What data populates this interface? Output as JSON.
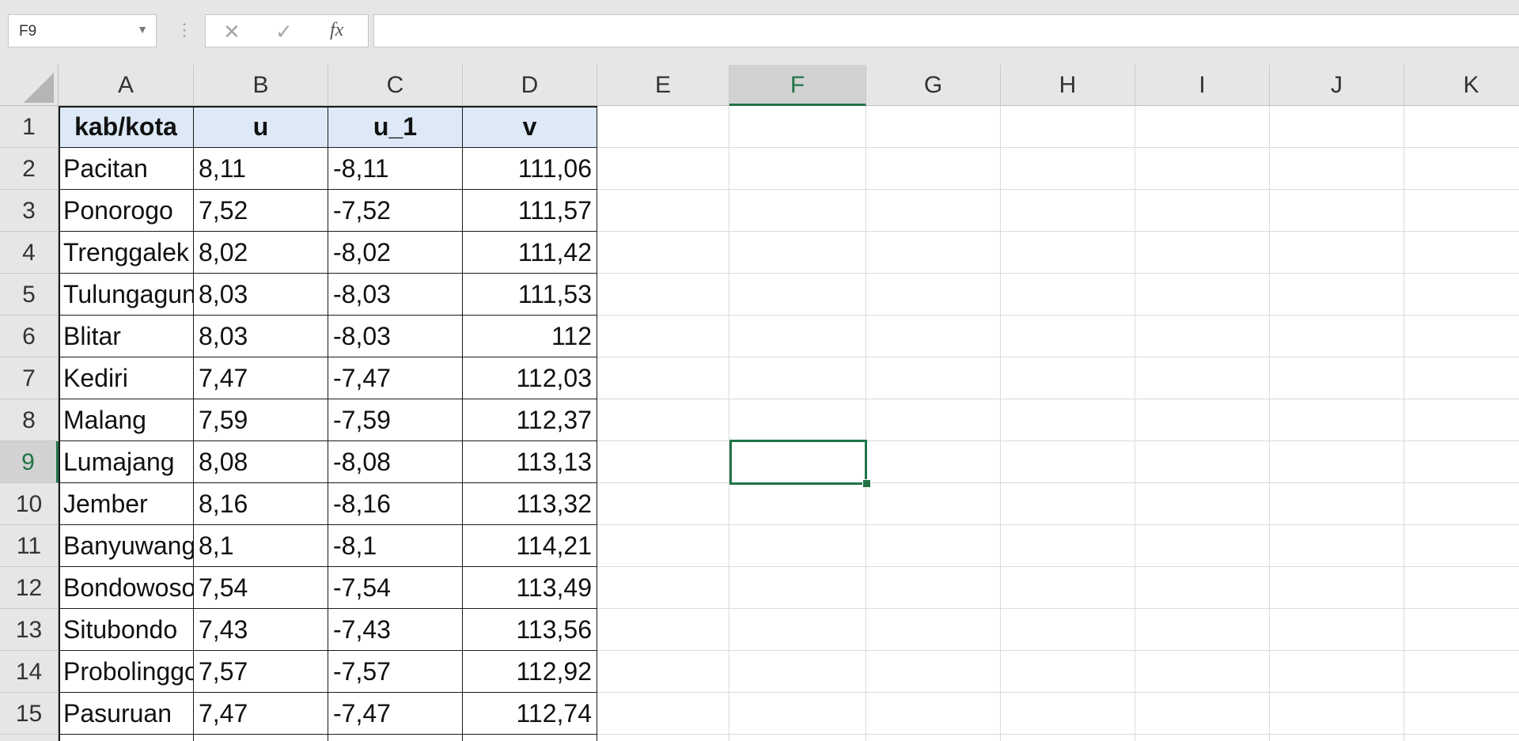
{
  "name_box": {
    "value": "F9"
  },
  "formula_bar": {
    "cancel_icon": "✕",
    "enter_icon": "✓",
    "fx_label": "fx",
    "value": ""
  },
  "columns": [
    "A",
    "B",
    "C",
    "D",
    "E",
    "F",
    "G",
    "H",
    "I",
    "J",
    "K"
  ],
  "selected_column": "F",
  "selected_row": "9",
  "rows": [
    "1",
    "2",
    "3",
    "4",
    "5",
    "6",
    "7",
    "8",
    "9",
    "10",
    "11",
    "12",
    "13",
    "14",
    "15"
  ],
  "table": {
    "headers": [
      "kab/kota",
      "u",
      "u_1",
      "v"
    ],
    "data": [
      [
        "Pacitan",
        "8,11",
        "-8,11",
        "111,06"
      ],
      [
        "Ponorogo",
        "7,52",
        "-7,52",
        "111,57"
      ],
      [
        "Trenggalek",
        "8,02",
        "-8,02",
        "111,42"
      ],
      [
        "Tulungagung",
        "8,03",
        "-8,03",
        "111,53"
      ],
      [
        "Blitar",
        "8,03",
        "-8,03",
        "112"
      ],
      [
        "Kediri",
        "7,47",
        "-7,47",
        "112,03"
      ],
      [
        "Malang",
        "7,59",
        "-7,59",
        "112,37"
      ],
      [
        "Lumajang",
        "8,08",
        "-8,08",
        "113,13"
      ],
      [
        "Jember",
        "8,16",
        "-8,16",
        "113,32"
      ],
      [
        "Banyuwangi",
        "8,1",
        "-8,1",
        "114,21"
      ],
      [
        "Bondowoso",
        "7,54",
        "-7,54",
        "113,49"
      ],
      [
        "Situbondo",
        "7,43",
        "-7,43",
        "113,56"
      ],
      [
        "Probolinggo",
        "7,57",
        "-7,57",
        "112,92"
      ],
      [
        "Pasuruan",
        "7,47",
        "-7,47",
        "112,74"
      ]
    ]
  },
  "colors": {
    "accent": "#217346",
    "header_fill": "#dde9f6"
  }
}
